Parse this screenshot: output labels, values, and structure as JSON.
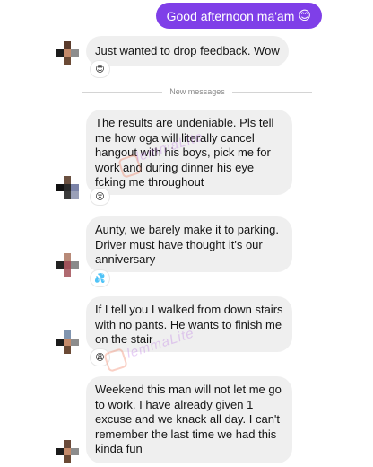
{
  "outgoing": {
    "text": "Good afternoon ma'am",
    "emoji": "😊"
  },
  "divider_label": "New messages",
  "watermark": "lemmaLite",
  "messages": [
    {
      "text": "Just wanted to drop feedback. Wow",
      "reaction": "😊"
    },
    {
      "text": "The results are undeniable. Pls tell me how oga will literally cancel hangout with his boys, pick me for work and during dinner his eye fcking me throughout",
      "reaction": "😮"
    },
    {
      "text": "Aunty, we barely make it to parking. Driver must have thought it's our anniversary",
      "reaction": "💦"
    },
    {
      "text": "If I tell you I walked from down stairs with no pants. He wants to finish me on the stair",
      "reaction": "😩"
    },
    {
      "text": "Weekend this man will not let me go to work. I have already given 1 excuse and we knack all day. I can't remember the last time we had this kinda fun",
      "reaction": ""
    }
  ]
}
